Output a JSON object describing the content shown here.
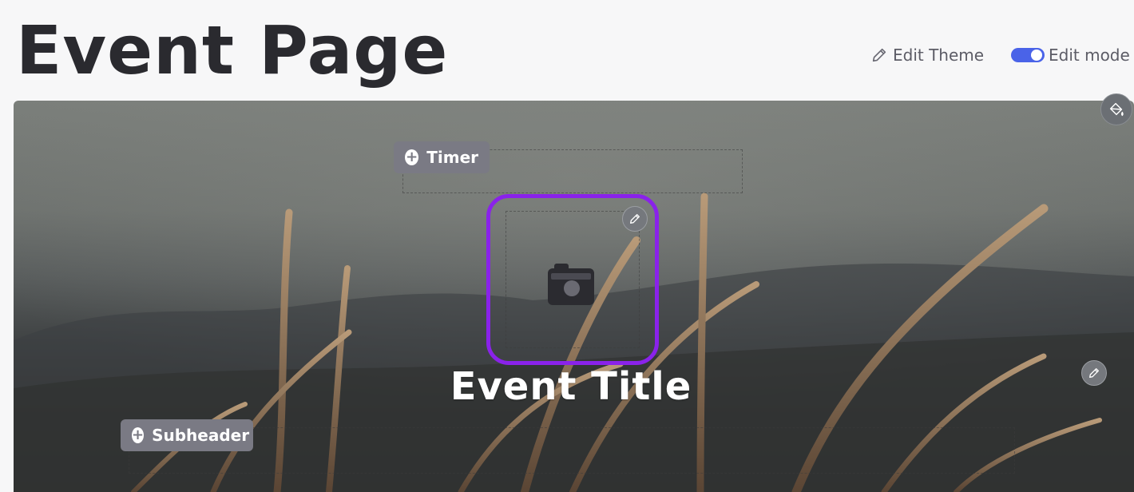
{
  "header": {
    "title": "Event Page",
    "edit_theme_label": "Edit Theme",
    "edit_mode_label": "Edit mode",
    "edit_mode_on": true
  },
  "hero": {
    "timer_label": "Timer",
    "subheader_label": "Subheader",
    "event_title": "Event Title"
  },
  "colors": {
    "accent": "#4a63e8",
    "selection": "#8a22ea",
    "chip": "#7a7a84"
  },
  "icons": [
    "pencil-icon",
    "toggle-icon",
    "paint-bucket-icon",
    "plus-icon",
    "camera-icon"
  ]
}
